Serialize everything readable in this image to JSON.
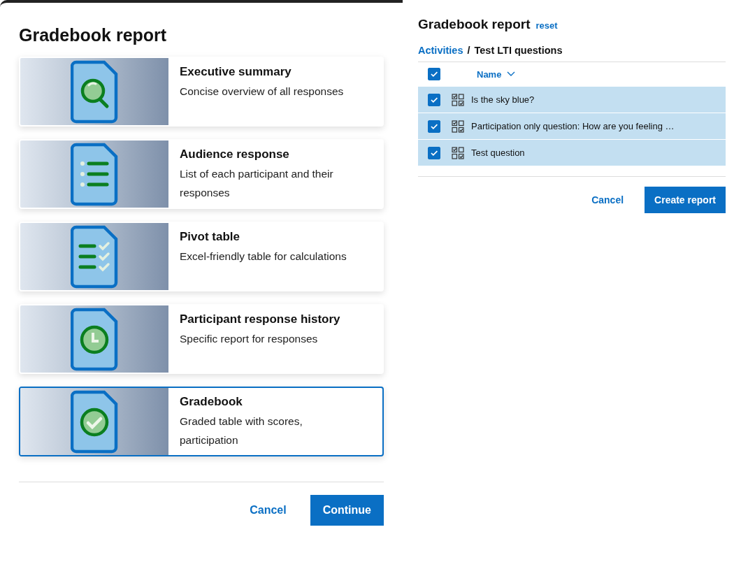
{
  "report_types": {
    "title": "Gradebook report",
    "cards": [
      {
        "kind": "magnifier",
        "title": "Executive summary",
        "description": "Concise overview of all responses",
        "selected": false
      },
      {
        "kind": "list",
        "title": "Audience response",
        "description": "List of each participant and their responses",
        "selected": false
      },
      {
        "kind": "checklist",
        "title": "Pivot table",
        "description": "Excel-friendly table for calculations",
        "selected": false
      },
      {
        "kind": "clock",
        "title": "Participant response history",
        "description": "Specific report for responses",
        "selected": false
      },
      {
        "kind": "check",
        "title": "Gradebook",
        "description": "Graded table with scores, participation",
        "selected": true
      }
    ],
    "buttons": {
      "cancel": "Cancel",
      "continue": "Continue"
    }
  },
  "question_picker": {
    "title": "Gradebook report",
    "reset": "reset",
    "breadcrumb": {
      "parent": "Activities",
      "separator": "/",
      "current": "Test LTI questions"
    },
    "header": {
      "checked": true,
      "column": "Name"
    },
    "rows": [
      {
        "name": "Is the sky blue?",
        "checked": true,
        "selected": true
      },
      {
        "name": "Participation only question: How are you feeling …",
        "checked": true,
        "selected": true
      },
      {
        "name": "Test question",
        "checked": true,
        "selected": true
      }
    ],
    "buttons": {
      "cancel": "Cancel",
      "create": "Create report"
    }
  }
}
